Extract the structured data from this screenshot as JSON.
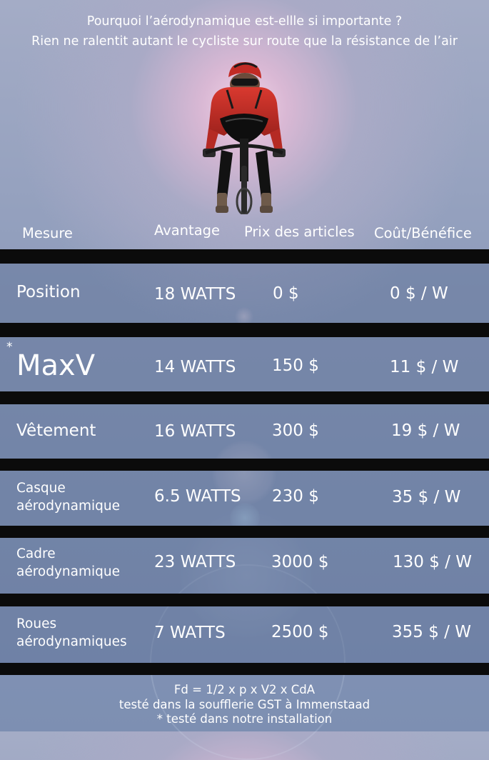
{
  "header": {
    "line1": "Pourquoi l’aérodynamique est-ellle si importante ?",
    "line2": "Rien ne ralentit autant le cycliste sur route que la résistance de l’air"
  },
  "columns": {
    "measure": "Mesure",
    "advantage": "Avantage",
    "price": "Prix des articles",
    "cost_benefit": "Coût/Bénéfice"
  },
  "rows": [
    {
      "label": "Position",
      "advantage": "18 WATTS",
      "price": "0 $",
      "cost_benefit": "0 $ / W"
    },
    {
      "label": "MaxV",
      "marker": "*",
      "advantage": "14 WATTS",
      "price": "150 $",
      "cost_benefit": "11 $ / W"
    },
    {
      "label": "Vêtement",
      "advantage": "16 WATTS",
      "price": "300 $",
      "cost_benefit": "19 $ / W"
    },
    {
      "label_line1": "Casque",
      "label_line2": "aérodynamique",
      "advantage": "6.5 WATTS",
      "price": "230 $",
      "cost_benefit": "35 $ / W"
    },
    {
      "label_line1": "Cadre",
      "label_line2": "aérodynamique",
      "advantage": "23 WATTS",
      "price": "3000 $",
      "cost_benefit": "130 $ / W"
    },
    {
      "label_line1": "Roues",
      "label_line2": "aérodynamiques",
      "advantage": "7 WATTS",
      "price": "2500 $",
      "cost_benefit": "355 $ / W"
    }
  ],
  "footer": {
    "formula": "Fd = 1/2 x p x V2 x CdA",
    "line2": "testé dans la soufflerie GST à Immenstaad",
    "line3": "* testé dans notre installation"
  },
  "colors": {
    "background": "#8e9cbb",
    "separator": "#0b0b0b",
    "jersey": "#c8302a",
    "text": "#ffffff"
  },
  "icons": [
    "cyclist-illustration"
  ]
}
